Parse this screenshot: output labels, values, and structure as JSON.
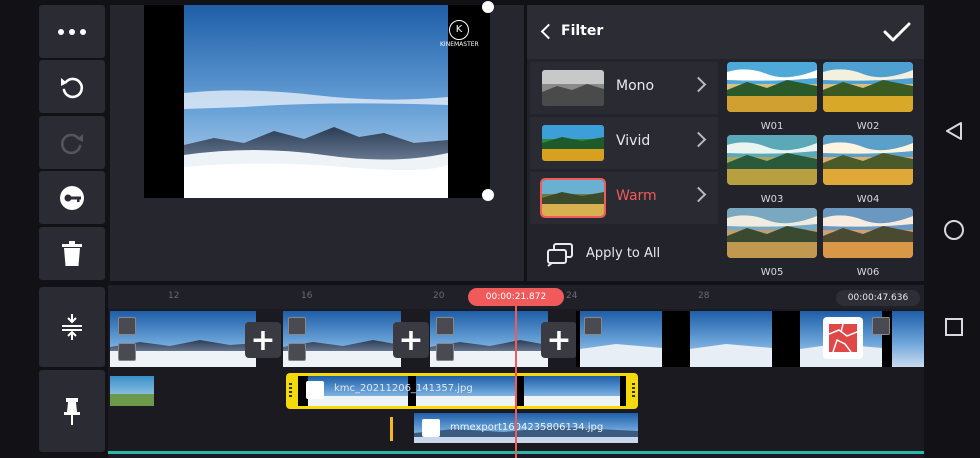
{
  "left_toolbar": {
    "items": [
      {
        "name": "more",
        "icon": "more-dots-icon",
        "enabled": true
      },
      {
        "name": "undo",
        "icon": "undo-icon",
        "enabled": true
      },
      {
        "name": "redo",
        "icon": "redo-icon",
        "enabled": false
      },
      {
        "name": "key",
        "icon": "keyframe-icon",
        "enabled": true
      },
      {
        "name": "delete",
        "icon": "trash-icon",
        "enabled": true
      }
    ]
  },
  "preview": {
    "watermark": "KINEMASTER"
  },
  "filter_panel": {
    "title": "Filter",
    "confirm_icon": "checkmark-icon",
    "categories": [
      {
        "label": "Mono",
        "selected": false
      },
      {
        "label": "Vivid",
        "selected": false
      },
      {
        "label": "Warm",
        "selected": true
      }
    ],
    "apply_all_label": "Apply to All",
    "presets": [
      "W01",
      "W02",
      "W03",
      "W04",
      "W05",
      "W06"
    ],
    "accent": "#f05a5a"
  },
  "timeline": {
    "playhead_time": "00:00:21.872",
    "total_time": "00:00:47.636",
    "ruler_labels": [
      "12",
      "16",
      "20",
      "24",
      "28"
    ],
    "layer1_label": "kmc_20211206_141357.jpg",
    "layer2_label": "mmexport1604235806134.jpg",
    "selected_color": "#f5d90a",
    "playhead_color": "#f05a5a"
  },
  "side_tools": {
    "top_icon": "layer-compress-icon",
    "bottom_icon": "pin-icon"
  },
  "system_nav": {
    "back": "back-triangle-icon",
    "home": "home-circle-icon",
    "recents": "recents-square-icon"
  }
}
